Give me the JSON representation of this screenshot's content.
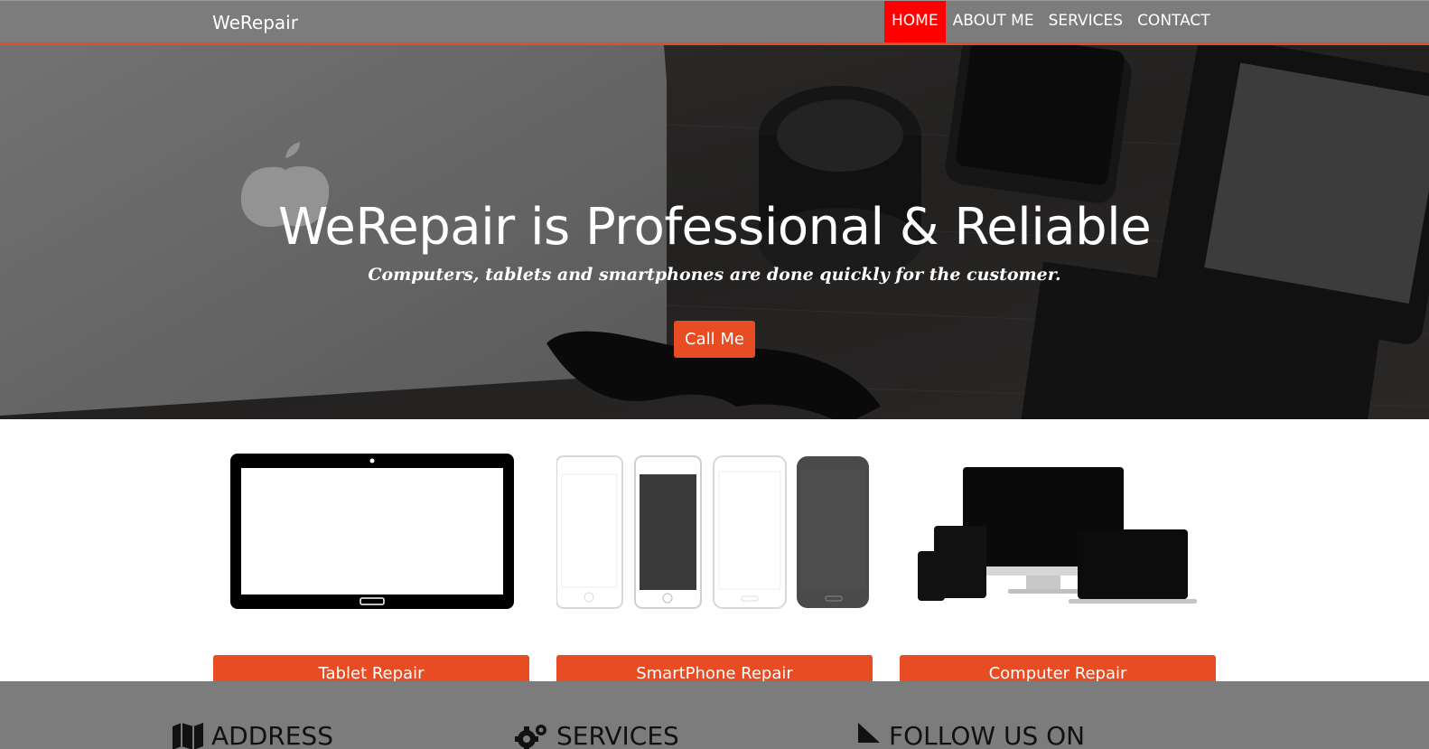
{
  "navbar": {
    "brand": "WeRepair",
    "items": [
      {
        "label": "HOME",
        "active": true
      },
      {
        "label": "ABOUT ME",
        "active": false
      },
      {
        "label": "SERVICES",
        "active": false
      },
      {
        "label": "CONTACT",
        "active": false
      }
    ]
  },
  "hero": {
    "title": "WeRepair is Professional & Reliable",
    "subtitle": "Computers, tablets and smartphones are done quickly for the customer.",
    "cta_label": "Call Me"
  },
  "services": [
    {
      "label": "Tablet Repair",
      "image": "tablet-image"
    },
    {
      "label": "SmartPhone Repair",
      "image": "smartphones-image"
    },
    {
      "label": "Computer Repair",
      "image": "devices-image"
    }
  ],
  "footer": {
    "columns": [
      {
        "icon": "map-icon",
        "label": "ADDRESS"
      },
      {
        "icon": "gears-icon",
        "label": "SERVICES"
      },
      {
        "icon": "pointer-icon",
        "label": "FOLLOW US ON"
      }
    ]
  },
  "colors": {
    "navbar_bg": "#7c7c7c",
    "accent": "#e84c22",
    "active_nav": "#ff0000",
    "footer_bg": "#7c7c7c"
  }
}
